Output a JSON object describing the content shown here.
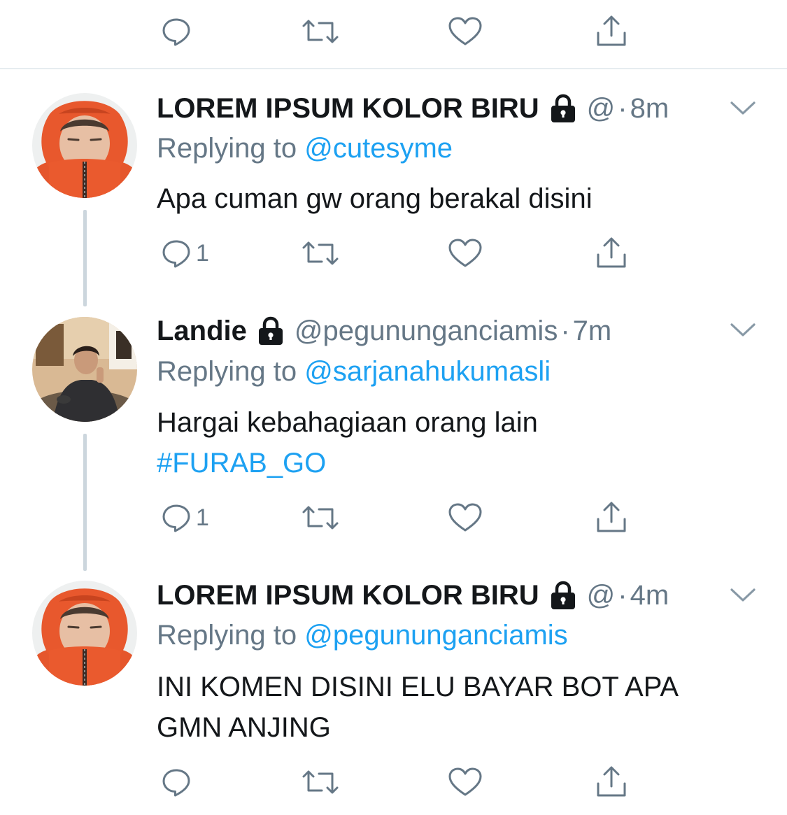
{
  "colors": {
    "text": "#14171a",
    "secondary": "#657786",
    "link": "#1da1f2",
    "divider": "#e6ecf0",
    "thread_line": "#ccd6dd"
  },
  "icons": {
    "reply": "reply-icon",
    "retweet": "retweet-icon",
    "like": "heart-icon",
    "share": "share-icon",
    "lock": "lock-icon",
    "menu": "chevron-down-icon"
  },
  "top_actions": {
    "reply_count": ""
  },
  "tweets": [
    {
      "name": "LOREM IPSUM KOLOR BIRU",
      "handle": "@",
      "separator": "·",
      "time": "8m",
      "replying_prefix": "Replying to",
      "replying_to": "@cutesyme",
      "text": "Apa cuman gw orang berakal disini",
      "hashtag": "",
      "reply_count": "1"
    },
    {
      "name": "Landie",
      "handle": "@pegununganciamis",
      "separator": "·",
      "time": "7m",
      "replying_prefix": "Replying to",
      "replying_to": "@sarjanahukumasli",
      "text": "Hargai kebahagiaan orang lain",
      "hashtag": "#FURAB_GO",
      "reply_count": "1"
    },
    {
      "name": "LOREM IPSUM KOLOR BIRU",
      "handle": "@",
      "separator": "·",
      "time": "4m",
      "replying_prefix": "Replying to",
      "replying_to": "@pegununganciamis",
      "text": "INI KOMEN DISINI ELU BAYAR BOT APA GMN ANJING",
      "hashtag": "",
      "reply_count": ""
    }
  ]
}
